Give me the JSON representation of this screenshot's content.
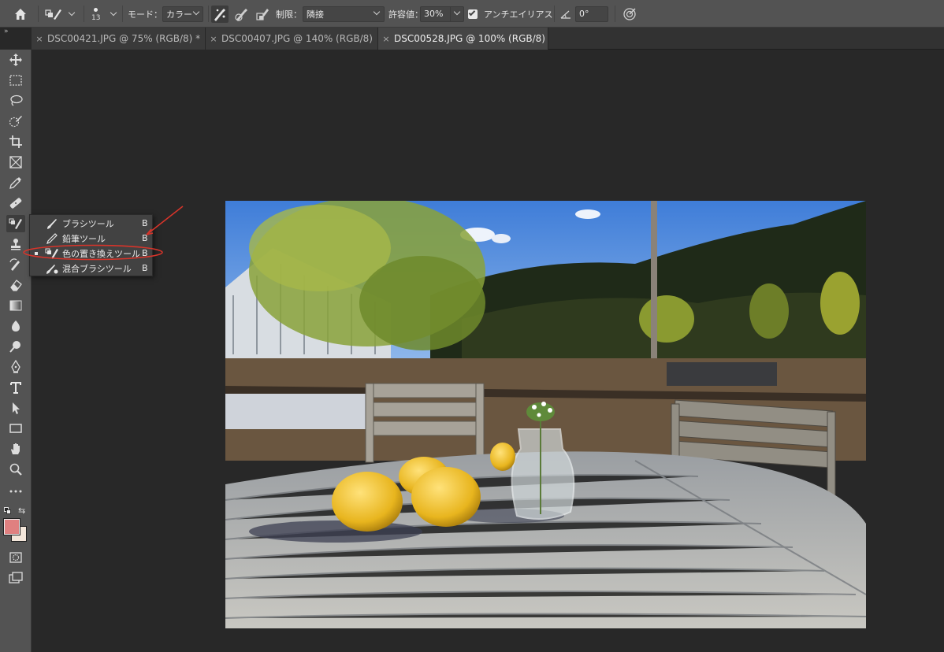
{
  "options_bar": {
    "brush_size": "13",
    "mode_label": "モード：",
    "mode_value": "カラー",
    "limit_label": "制限：",
    "limit_value": "隣接",
    "tolerance_label": "許容値：",
    "tolerance_value": "30%",
    "antialias_label": "アンチエイリアス",
    "antialias_checked": true,
    "angle_value": "0°"
  },
  "tabs": [
    {
      "label": "DSC00421.JPG @ 75% (RGB/8) *",
      "active": false
    },
    {
      "label": "DSC00407.JPG @ 140% (RGB/8)",
      "active": false
    },
    {
      "label": "DSC00528.JPG @ 100% (RGB/8)",
      "active": true
    }
  ],
  "collapse_label": "»",
  "flyout_menu": {
    "items": [
      {
        "label": "ブラシツール",
        "shortcut": "B",
        "selected": false
      },
      {
        "label": "鉛筆ツール",
        "shortcut": "B",
        "selected": false
      },
      {
        "label": "色の置き換えツール",
        "shortcut": "B",
        "selected": true
      },
      {
        "label": "混合ブラシツール",
        "shortcut": "B",
        "selected": false
      }
    ]
  },
  "colors": {
    "foreground": "#e08080",
    "background": "#f3e6da",
    "annotation": "#d8342a"
  },
  "icons": [
    "home-icon",
    "move-icon",
    "marquee-icon",
    "lasso-icon",
    "quick-select-icon",
    "crop-icon",
    "frame-icon",
    "eyedropper-icon",
    "healing-icon",
    "brush-icon",
    "stamp-icon",
    "history-brush-icon",
    "eraser-icon",
    "gradient-icon",
    "blur-icon",
    "dodge-icon",
    "pen-icon",
    "type-icon",
    "path-select-icon",
    "rectangle-icon",
    "hand-icon",
    "zoom-icon",
    "more-icon",
    "quickmask-icon",
    "screen-mode-icon"
  ]
}
